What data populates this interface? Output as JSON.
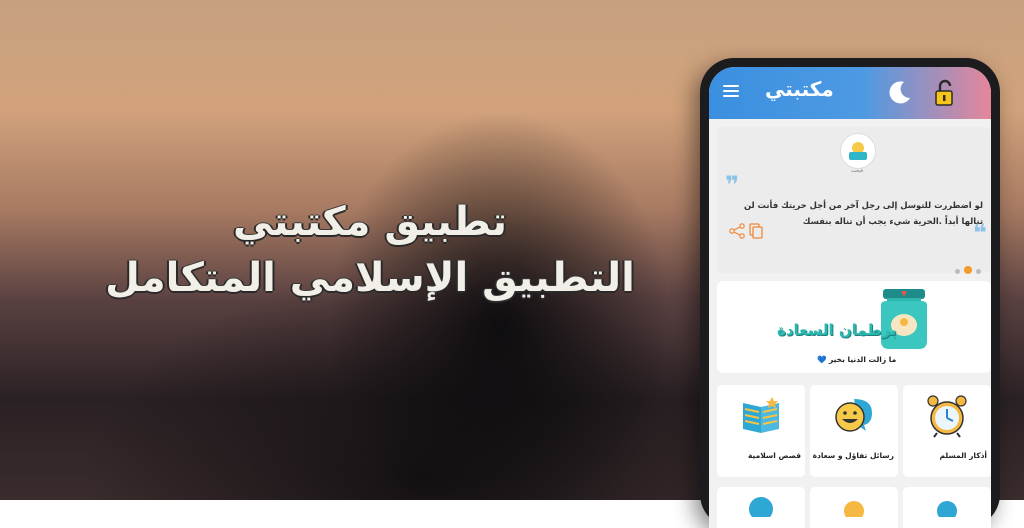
{
  "headline": {
    "line1": "تطبيق مكتبتي",
    "line2": "التطبيق الإسلامي المتكامل"
  },
  "app": {
    "title": "مكتبتي",
    "logo_text": "مكتبتي",
    "logo_sub": "فيجت",
    "quote": "لو اضطررت للتوسل إلى رجل آخر من أجل حريتك فأنت لن تنالها أبداً .الحرية شيء يجب أن تناله بنفسك",
    "carousel_active": 2,
    "jar_title": "برطمان السعادة",
    "jar_subtitle": "ما زالت الدنيا بخير 💙",
    "tiles": [
      {
        "label": "قصص اسلامية",
        "icon": "book-icon"
      },
      {
        "label": "رسائل تفاؤل و سعادة",
        "icon": "smile-chat-icon"
      },
      {
        "label": "أذكار المسلم",
        "icon": "alarm-clock-icon"
      }
    ]
  },
  "colors": {
    "appbar_start": "#3a8fe0",
    "appbar_end": "#e6869a",
    "accent_orange": "#f39a2a",
    "jar_teal": "#2db7b1"
  }
}
